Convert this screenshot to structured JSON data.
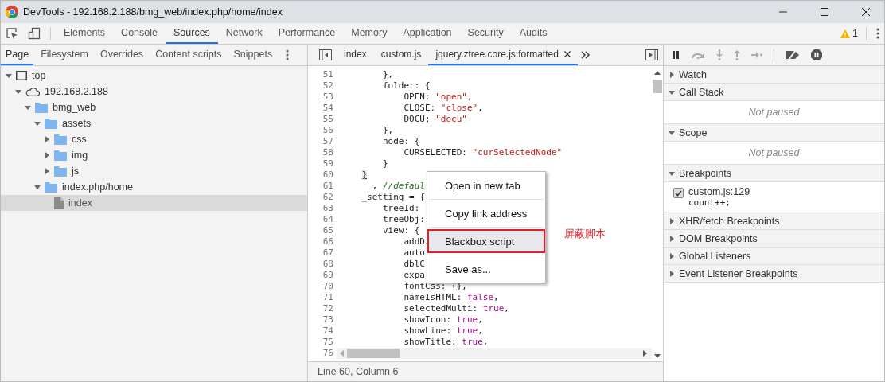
{
  "window": {
    "title": "DevTools - 192.168.2.188/bmg_web/index.php/home/index"
  },
  "main_tabs": [
    {
      "label": "Elements",
      "selected": false
    },
    {
      "label": "Console",
      "selected": false
    },
    {
      "label": "Sources",
      "selected": true
    },
    {
      "label": "Network",
      "selected": false
    },
    {
      "label": "Performance",
      "selected": false
    },
    {
      "label": "Memory",
      "selected": false
    },
    {
      "label": "Application",
      "selected": false
    },
    {
      "label": "Security",
      "selected": false
    },
    {
      "label": "Audits",
      "selected": false
    }
  ],
  "warnings": {
    "count": "1"
  },
  "navigator_tabs": [
    {
      "label": "Page",
      "selected": true
    },
    {
      "label": "Filesystem",
      "selected": false
    },
    {
      "label": "Overrides",
      "selected": false
    },
    {
      "label": "Content scripts",
      "selected": false
    },
    {
      "label": "Snippets",
      "selected": false
    }
  ],
  "file_tree": [
    {
      "label": "top",
      "kind": "frame",
      "expanded": true,
      "selected": false,
      "children": [
        {
          "label": "192.168.2.188",
          "kind": "domain",
          "expanded": true,
          "selected": false,
          "children": [
            {
              "label": "bmg_web",
              "kind": "folder",
              "expanded": true,
              "selected": false,
              "children": [
                {
                  "label": "assets",
                  "kind": "folder",
                  "expanded": true,
                  "selected": false,
                  "children": [
                    {
                      "label": "css",
                      "kind": "folder",
                      "expanded": false,
                      "selected": false
                    },
                    {
                      "label": "img",
                      "kind": "folder",
                      "expanded": false,
                      "selected": false
                    },
                    {
                      "label": "js",
                      "kind": "folder",
                      "expanded": false,
                      "selected": false
                    }
                  ]
                },
                {
                  "label": "index.php/home",
                  "kind": "folder",
                  "expanded": true,
                  "selected": false,
                  "children": [
                    {
                      "label": "index",
                      "kind": "file",
                      "selected": true
                    }
                  ]
                }
              ]
            }
          ]
        }
      ]
    }
  ],
  "editor_tabs": [
    {
      "label": "index",
      "selected": false,
      "closable": false
    },
    {
      "label": "custom.js",
      "selected": false,
      "closable": false
    },
    {
      "label": "jquery.ztree.core.js:formatted",
      "selected": true,
      "closable": true
    }
  ],
  "code_lines": [
    {
      "number": "51",
      "tokens": [
        {
          "text": "        },",
          "kind": "plain"
        }
      ]
    },
    {
      "number": "52",
      "tokens": [
        {
          "text": "        folder: {",
          "kind": "plain"
        }
      ]
    },
    {
      "number": "53",
      "tokens": [
        {
          "text": "            OPEN: ",
          "kind": "plain"
        },
        {
          "text": "\"open\"",
          "kind": "string"
        },
        {
          "text": ",",
          "kind": "plain"
        }
      ]
    },
    {
      "number": "54",
      "tokens": [
        {
          "text": "            CLOSE: ",
          "kind": "plain"
        },
        {
          "text": "\"close\"",
          "kind": "string"
        },
        {
          "text": ",",
          "kind": "plain"
        }
      ]
    },
    {
      "number": "55",
      "tokens": [
        {
          "text": "            DOCU: ",
          "kind": "plain"
        },
        {
          "text": "\"docu\"",
          "kind": "string"
        }
      ]
    },
    {
      "number": "56",
      "tokens": [
        {
          "text": "        },",
          "kind": "plain"
        }
      ]
    },
    {
      "number": "57",
      "tokens": [
        {
          "text": "        node: {",
          "kind": "plain"
        }
      ]
    },
    {
      "number": "58",
      "tokens": [
        {
          "text": "            CURSELECTED: ",
          "kind": "plain"
        },
        {
          "text": "\"curSelectedNode\"",
          "kind": "string"
        }
      ]
    },
    {
      "number": "59",
      "tokens": [
        {
          "text": "        }",
          "kind": "plain"
        }
      ]
    },
    {
      "number": "60",
      "tokens": [
        {
          "text": "    }",
          "kind": "match"
        }
      ]
    },
    {
      "number": "61",
      "tokens": [
        {
          "text": "      , ",
          "kind": "plain"
        },
        {
          "text": "//defaul",
          "kind": "comment"
        }
      ]
    },
    {
      "number": "62",
      "tokens": [
        {
          "text": "    _setting = {",
          "kind": "plain"
        }
      ]
    },
    {
      "number": "63",
      "tokens": [
        {
          "text": "        treeId:",
          "kind": "plain"
        }
      ]
    },
    {
      "number": "64",
      "tokens": [
        {
          "text": "        treeObj:",
          "kind": "plain"
        }
      ]
    },
    {
      "number": "65",
      "tokens": [
        {
          "text": "        view: {",
          "kind": "plain"
        }
      ]
    },
    {
      "number": "66",
      "tokens": [
        {
          "text": "            addD",
          "kind": "plain"
        }
      ]
    },
    {
      "number": "67",
      "tokens": [
        {
          "text": "            auto",
          "kind": "plain"
        }
      ]
    },
    {
      "number": "68",
      "tokens": [
        {
          "text": "            dblC",
          "kind": "plain"
        }
      ]
    },
    {
      "number": "69",
      "tokens": [
        {
          "text": "            expa",
          "kind": "plain"
        }
      ]
    },
    {
      "number": "70",
      "tokens": [
        {
          "text": "            fontCss: {},",
          "kind": "plain"
        }
      ]
    },
    {
      "number": "71",
      "tokens": [
        {
          "text": "            nameIsHTML: ",
          "kind": "plain"
        },
        {
          "text": "false",
          "kind": "keyword"
        },
        {
          "text": ",",
          "kind": "plain"
        }
      ]
    },
    {
      "number": "72",
      "tokens": [
        {
          "text": "            selectedMulti: ",
          "kind": "plain"
        },
        {
          "text": "true",
          "kind": "keyword"
        },
        {
          "text": ",",
          "kind": "plain"
        }
      ]
    },
    {
      "number": "73",
      "tokens": [
        {
          "text": "            showIcon: ",
          "kind": "plain"
        },
        {
          "text": "true",
          "kind": "keyword"
        },
        {
          "text": ",",
          "kind": "plain"
        }
      ]
    },
    {
      "number": "74",
      "tokens": [
        {
          "text": "            showLine: ",
          "kind": "plain"
        },
        {
          "text": "true",
          "kind": "keyword"
        },
        {
          "text": ",",
          "kind": "plain"
        }
      ]
    },
    {
      "number": "75",
      "tokens": [
        {
          "text": "            showTitle: ",
          "kind": "plain"
        },
        {
          "text": "true",
          "kind": "keyword"
        },
        {
          "text": ",",
          "kind": "plain"
        }
      ]
    },
    {
      "number": "76"
    }
  ],
  "context_menu": [
    {
      "label": "Open in new tab",
      "selected": false,
      "annotated": false
    },
    {
      "label": "Copy link address",
      "selected": false,
      "annotated": false
    },
    {
      "label": "Blackbox script",
      "selected": true,
      "annotated": true
    },
    {
      "label": "Save as...",
      "selected": false,
      "annotated": false
    }
  ],
  "annotation": {
    "text": "屏蔽脚本"
  },
  "status_bar": {
    "position": "Line 60, Column 6"
  },
  "debugger_sections": [
    {
      "title": "Watch",
      "expanded": false
    },
    {
      "title": "Call Stack",
      "expanded": true,
      "message": "Not paused"
    },
    {
      "title": "Scope",
      "expanded": true,
      "message": "Not paused"
    },
    {
      "title": "Breakpoints",
      "expanded": true,
      "breakpoints": [
        {
          "location": "custom.js:129",
          "code": "count++;",
          "checked": true
        }
      ]
    },
    {
      "title": "XHR/fetch Breakpoints",
      "expanded": false
    },
    {
      "title": "DOM Breakpoints",
      "expanded": false
    },
    {
      "title": "Global Listeners",
      "expanded": false
    },
    {
      "title": "Event Listener Breakpoints",
      "expanded": false
    }
  ]
}
